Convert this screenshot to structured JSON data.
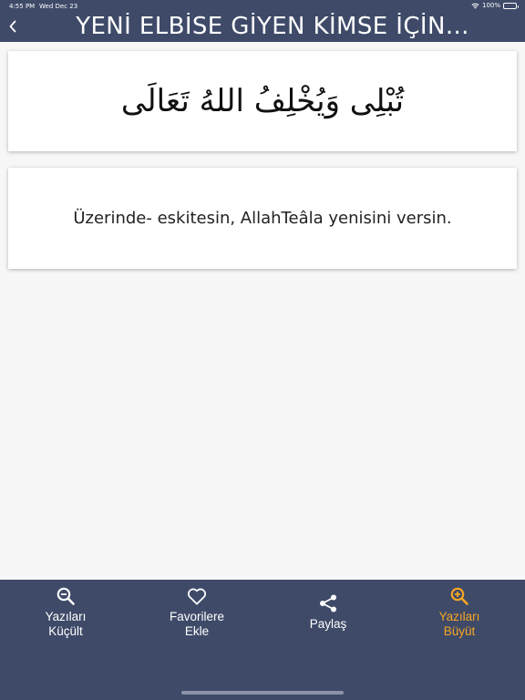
{
  "status_bar": {
    "time": "4:55 PM",
    "date": "Wed Dec 23",
    "battery_text": "100%"
  },
  "header": {
    "back_icon": "chevron-left-icon",
    "title": "YENİ ELBİSE GİYEN KİMSE İÇİN..."
  },
  "content": {
    "arabic_text": "تُبْلِى وَيُخْلِفُ اللهُ تَعَالَى",
    "translation": "Üzerinde- eskitesin, AllahTeâla yenisini versin."
  },
  "tabs": [
    {
      "label": "Yazıları\nKüçült",
      "icon": "zoom-out-icon",
      "active": false
    },
    {
      "label": "Favorilere\nEkle",
      "icon": "heart-icon",
      "active": false
    },
    {
      "label": "Paylaş",
      "icon": "share-icon",
      "active": false
    },
    {
      "label": "Yazıları\nBüyüt",
      "icon": "zoom-in-icon",
      "active": true
    }
  ],
  "colors": {
    "bar_background": "#3e4a68",
    "active_tab": "#f6a623",
    "page_background": "#f7f7f7"
  }
}
